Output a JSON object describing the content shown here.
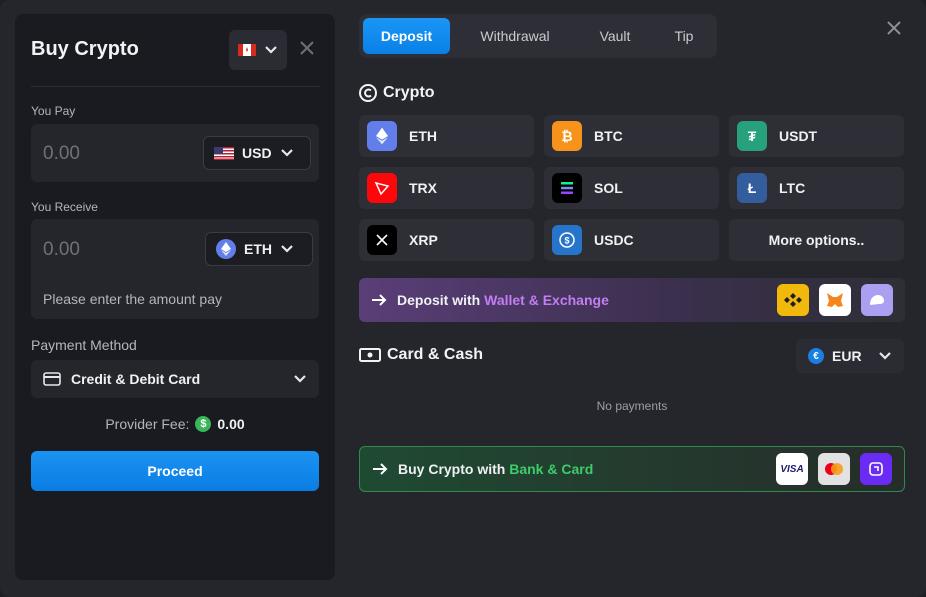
{
  "left": {
    "title": "Buy Crypto",
    "you_pay_label": "You Pay",
    "pay_amount": "0.00",
    "pay_currency": "USD",
    "you_receive_label": "You Receive",
    "receive_amount": "0.00",
    "receive_currency": "ETH",
    "hint": "Please enter the amount pay",
    "payment_method_label": "Payment Method",
    "payment_method": "Credit & Debit Card",
    "fee_label": "Provider Fee:",
    "fee_value": "0.00",
    "proceed_label": "Proceed"
  },
  "tabs": [
    "Deposit",
    "Withdrawal",
    "Vault",
    "Tip"
  ],
  "crypto_section": {
    "title": "Crypto",
    "coins": [
      {
        "symbol": "ETH",
        "color": "#627eea"
      },
      {
        "symbol": "BTC",
        "color": "#f7931a"
      },
      {
        "symbol": "USDT",
        "color": "#26a17b"
      },
      {
        "symbol": "TRX",
        "color": "#ff060a"
      },
      {
        "symbol": "SOL",
        "color": "#000000"
      },
      {
        "symbol": "LTC",
        "color": "#345d9d"
      },
      {
        "symbol": "XRP",
        "color": "#000000"
      },
      {
        "symbol": "USDC",
        "color": "#2775ca"
      }
    ],
    "more_label": "More options.."
  },
  "wallet_banner": {
    "prefix": "Deposit with",
    "highlight": "Wallet & Exchange"
  },
  "card_section": {
    "title": "Card & Cash",
    "currency": "EUR",
    "empty_text": "No payments"
  },
  "bank_banner": {
    "prefix": "Buy Crypto with",
    "highlight": "Bank & Card",
    "visa_label": "VISA"
  }
}
